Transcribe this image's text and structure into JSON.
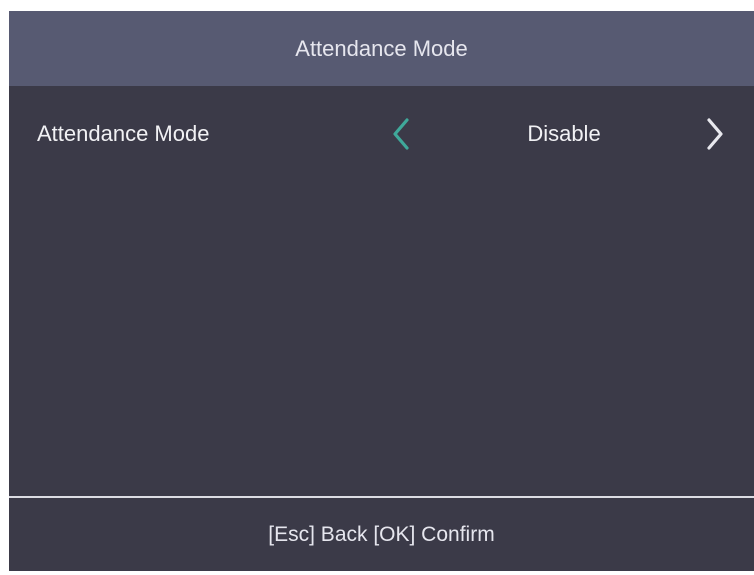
{
  "header": {
    "title": "Attendance Mode"
  },
  "setting": {
    "label": "Attendance Mode",
    "value": "Disable",
    "prev_icon": "chevron-left-icon",
    "next_icon": "chevron-right-icon"
  },
  "footer": {
    "hint": "[Esc] Back [OK] Confirm"
  },
  "colors": {
    "header_bg": "#575a72",
    "screen_bg": "#3b3a48",
    "accent": "#3fa89a",
    "text": "#f1f1f4"
  }
}
